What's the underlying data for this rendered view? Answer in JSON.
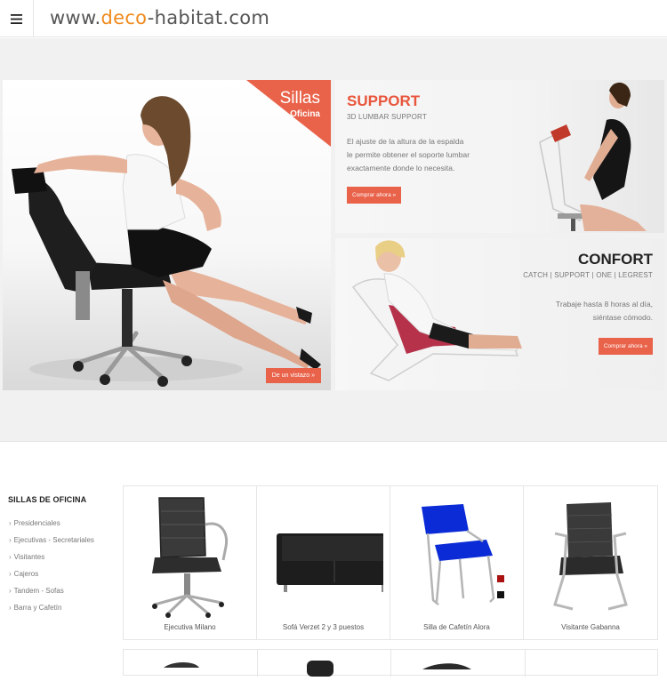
{
  "header": {
    "logo_prefix": "www.",
    "logo_accent": "deco",
    "logo_suffix": "-habitat.com"
  },
  "hero": {
    "corner_title": "Sillas",
    "corner_subtitle": "Oficina",
    "button_label": "De un vistazo »"
  },
  "support": {
    "title": "SUPPORT",
    "subtitle": "3D LUMBAR SUPPORT",
    "text_line1": "El ajuste de la altura de la espalda",
    "text_line2": "le permite obtener el soporte lumbar",
    "text_line3": "exactamente donde lo necesita.",
    "button_label": "Comprar ahora »"
  },
  "confort": {
    "title": "CONFORT",
    "subtitle": "CATCH | SUPPORT | ONE | LEGREST",
    "text_line1": "Trabaje hasta 8 horas al día,",
    "text_line2": "siéntase cómodo.",
    "button_label": "Comprar ahora »"
  },
  "sidebar": {
    "title": "SILLAS DE OFICINA",
    "items": [
      {
        "label": "Presidenciales"
      },
      {
        "label": "Ejecutivas - Secretariales"
      },
      {
        "label": "Visitantes"
      },
      {
        "label": "Cajeros"
      },
      {
        "label": "Tandem - Sofas"
      },
      {
        "label": "Barra y Cafetín"
      }
    ]
  },
  "products": [
    {
      "name": "Ejecutiva Milano"
    },
    {
      "name": "Sofá Verzet 2 y 3 puestos"
    },
    {
      "name": "Silla de Cafetín Alora"
    },
    {
      "name": "Visitante Gabanna"
    }
  ],
  "colors": {
    "accent": "#e9624a",
    "title_red": "#e8563c",
    "logo_orange": "#f08a1c",
    "product_blue": "#0a2bd6"
  },
  "icons": {
    "menu": "hamburger-icon",
    "arrow": "chevron-right-icon"
  }
}
